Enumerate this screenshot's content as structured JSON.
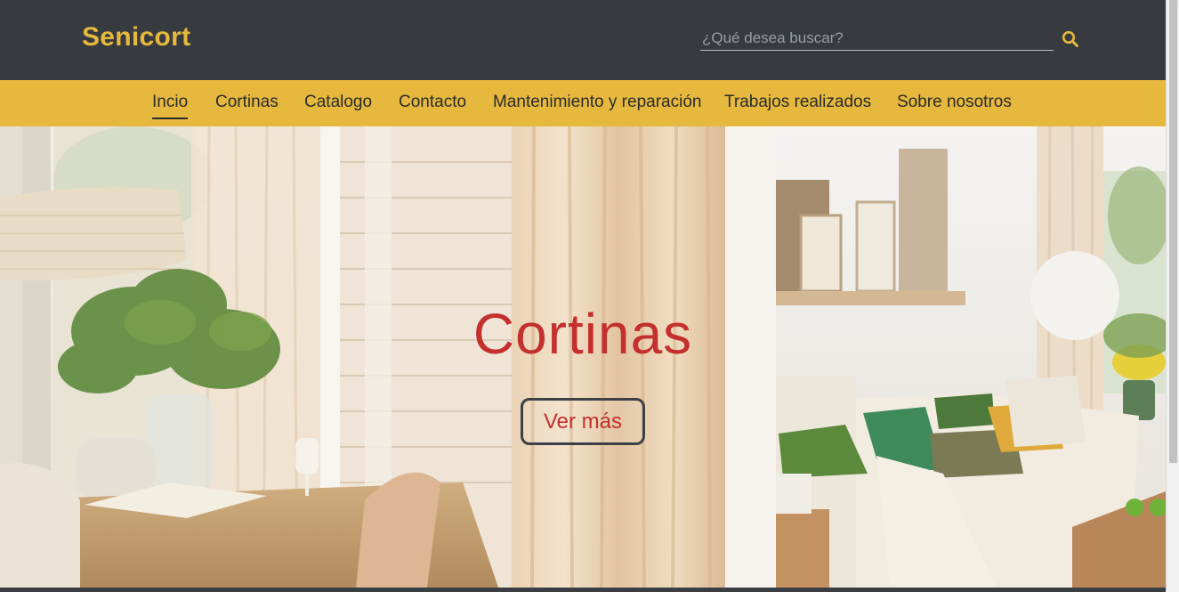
{
  "header": {
    "logo": "Senicort",
    "search_placeholder": "¿Qué desea buscar?",
    "search_icon": "search-icon"
  },
  "nav": {
    "items": [
      {
        "label": "Incio",
        "active": true
      },
      {
        "label": "Cortinas"
      },
      {
        "label": "Catalogo"
      },
      {
        "label": "Contacto"
      },
      {
        "label": "Mantenimiento y reparación"
      },
      {
        "label": "Trabajos realizados"
      },
      {
        "label": "Sobre nosotros"
      }
    ]
  },
  "hero": {
    "title": "Cortinas",
    "button_label": "Ver más"
  },
  "colors": {
    "header_bg": "#373b40",
    "accent": "#e6b93e",
    "hero_text": "#c4302d"
  }
}
